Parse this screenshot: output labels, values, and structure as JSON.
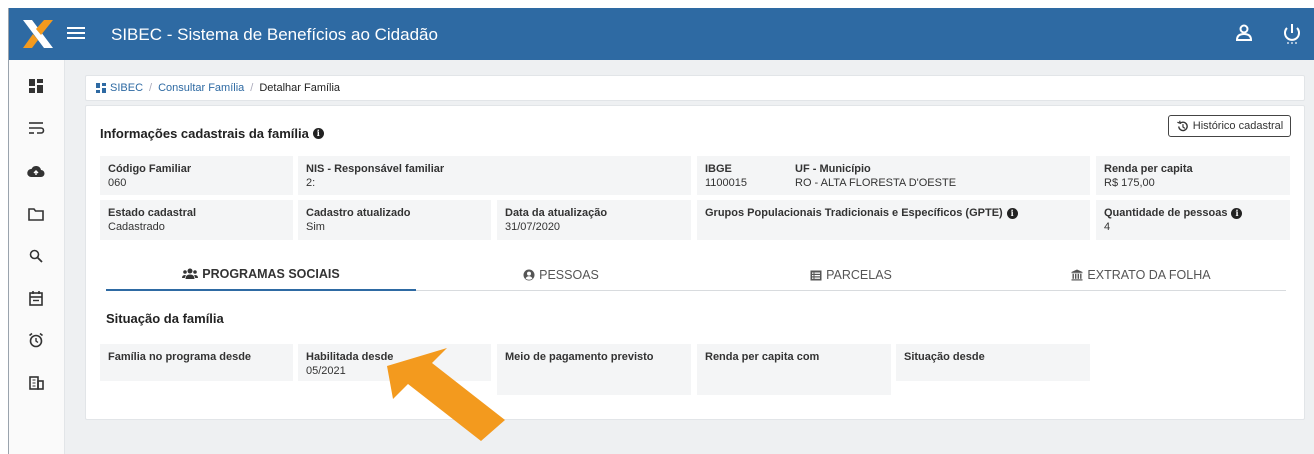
{
  "app": {
    "title": "SIBEC - Sistema de Benefícios ao Cidadão"
  },
  "breadcrumb": {
    "root": "SIBEC",
    "parent": "Consultar Família",
    "current": "Detalhar Família"
  },
  "card": {
    "title": "Informações cadastrais da família",
    "history_button": "Histórico cadastral"
  },
  "fields": {
    "codigo_familiar": {
      "label": "Código Familiar",
      "value": "060"
    },
    "nis": {
      "label": "NIS - Responsável familiar",
      "value": "2:"
    },
    "ibge": {
      "label": "IBGE",
      "value": "1100015"
    },
    "uf_municipio": {
      "label": "UF - Município",
      "value": "RO - ALTA FLORESTA D'OESTE"
    },
    "renda": {
      "label": "Renda per capita",
      "value": "R$ 175,00"
    },
    "estado": {
      "label": "Estado cadastral",
      "value": "Cadastrado"
    },
    "atualizado": {
      "label": "Cadastro atualizado",
      "value": "Sim"
    },
    "data_atualizacao": {
      "label": "Data da atualização",
      "value": "31/07/2020"
    },
    "gpte": {
      "label": "Grupos Populacionais Tradicionais e Específicos (GPTE)",
      "value": ""
    },
    "qtd_pessoas": {
      "label": "Quantidade de pessoas",
      "value": "4"
    }
  },
  "tabs": [
    {
      "label": "PROGRAMAS SOCIAIS"
    },
    {
      "label": "PESSOAS"
    },
    {
      "label": "PARCELAS"
    },
    {
      "label": "EXTRATO DA FOLHA"
    }
  ],
  "situacao": {
    "title": "Situação da família",
    "items": [
      {
        "label": "Família no programa desde",
        "value": ""
      },
      {
        "label": "Habilitada desde",
        "value": "05/2021"
      },
      {
        "label": "Meio de pagamento previsto",
        "value": ""
      },
      {
        "label": "Renda per capita com",
        "value": ""
      },
      {
        "label": "Situação desde",
        "value": ""
      }
    ]
  },
  "colors": {
    "primary": "#2e6aa3",
    "arrow": "#f39a1e",
    "logo_orange": "#f39a1e"
  },
  "icons": [
    "caixa-logo",
    "hamburger-menu-icon",
    "user-icon",
    "power-icon",
    "dashboard-icon",
    "list-icon",
    "cloud-upload-icon",
    "folder-icon",
    "search-icon",
    "calendar-icon",
    "alarm-clock-icon",
    "building-icon",
    "history-icon",
    "users-icon",
    "user-circle-icon",
    "list-alt-icon",
    "bank-icon"
  ]
}
